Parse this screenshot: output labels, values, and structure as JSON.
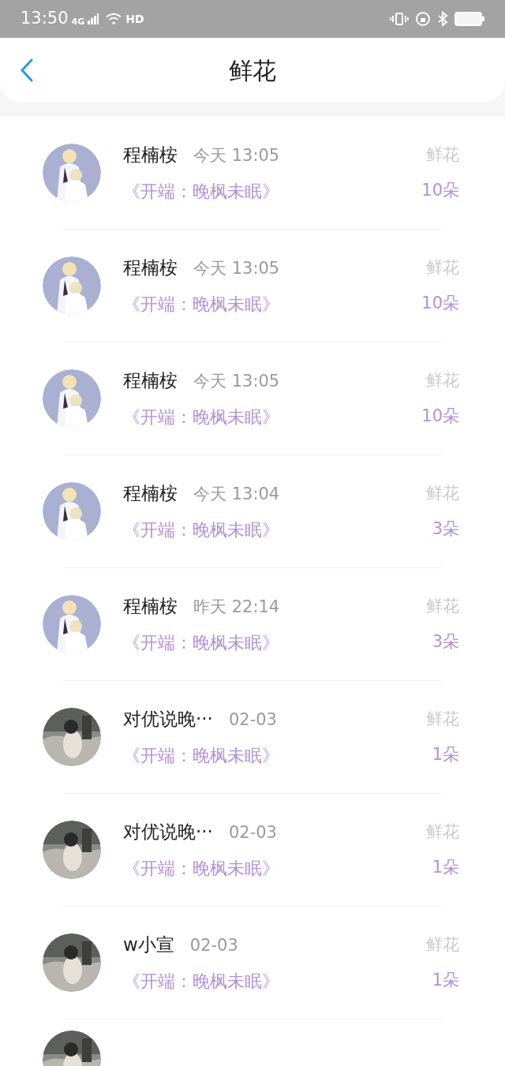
{
  "status_bar": {
    "time": "13:50",
    "network": "4G",
    "hd": "HD"
  },
  "header": {
    "title": "鲜花"
  },
  "rows": [
    {
      "name": "程楠桉",
      "time": "今天 13:05",
      "subtitle": "《开端：晚枫未眠》",
      "label": "鲜花",
      "count": "10朵"
    },
    {
      "name": "程楠桉",
      "time": "今天 13:05",
      "subtitle": "《开端：晚枫未眠》",
      "label": "鲜花",
      "count": "10朵"
    },
    {
      "name": "程楠桉",
      "time": "今天 13:05",
      "subtitle": "《开端：晚枫未眠》",
      "label": "鲜花",
      "count": "10朵"
    },
    {
      "name": "程楠桉",
      "time": "今天 13:04",
      "subtitle": "《开端：晚枫未眠》",
      "label": "鲜花",
      "count": "3朵"
    },
    {
      "name": "程楠桉",
      "time": "昨天 22:14",
      "subtitle": "《开端：晚枫未眠》",
      "label": "鲜花",
      "count": "3朵"
    },
    {
      "name": "对优说晚···",
      "time": "02-03",
      "subtitle": "《开端：晚枫未眠》",
      "label": "鲜花",
      "count": "1朵"
    },
    {
      "name": "对优说晚···",
      "time": "02-03",
      "subtitle": "《开端：晚枫未眠》",
      "label": "鲜花",
      "count": "1朵"
    },
    {
      "name": "w小宣",
      "time": "02-03",
      "subtitle": "《开端：晚枫未眠》",
      "label": "鲜花",
      "count": "1朵"
    }
  ]
}
